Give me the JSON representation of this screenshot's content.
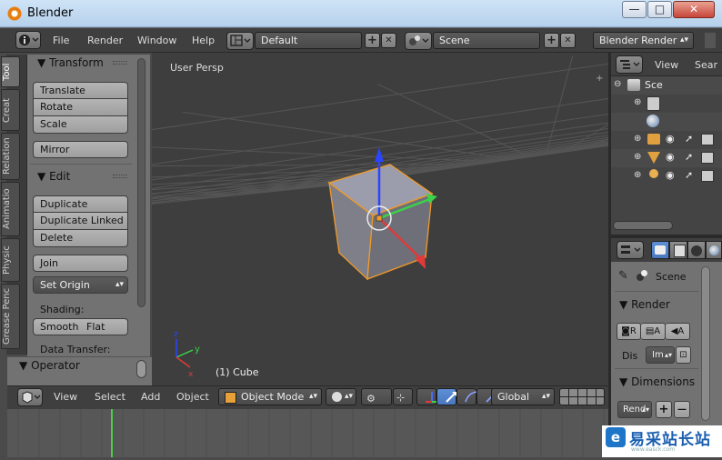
{
  "window": {
    "title": "Blender",
    "minimize_glyph": "—",
    "maximize_glyph": "□",
    "close_glyph": "✕"
  },
  "top_header": {
    "menus": [
      "File",
      "Render",
      "Window",
      "Help"
    ],
    "layout": "Default",
    "scene": "Scene",
    "engine": "Blender Render",
    "add_glyph": "+",
    "remove_glyph": "✕"
  },
  "tool_tabs": [
    "Tool",
    "Creat",
    "Relation",
    "Animatio",
    "Physic",
    "Grease Penc"
  ],
  "toolshelf": {
    "transform": {
      "title": "Transform",
      "buttons": [
        "Translate",
        "Rotate",
        "Scale"
      ],
      "mirror": "Mirror"
    },
    "edit": {
      "title": "Edit",
      "buttons": [
        "Duplicate",
        "Duplicate Linked",
        "Delete"
      ],
      "join": "Join",
      "set_origin": "Set Origin",
      "shading_label": "Shading:",
      "smooth": "Smooth",
      "flat": "Flat",
      "data_transfer": "Data Transfer:"
    },
    "operator": {
      "title": "Operator"
    }
  },
  "viewport": {
    "view_label": "User Persp",
    "object_label": "(1) Cube",
    "axis_x": "x",
    "axis_y": "y",
    "axis_z": "z",
    "colors": {
      "x_axis": "#e03a3a",
      "y_axis": "#3ad34a",
      "z_axis": "#2a45ff",
      "outline": "#f09a28"
    }
  },
  "viewport_header": {
    "menus": [
      "View",
      "Select",
      "Add",
      "Object"
    ],
    "mode": "Object Mode",
    "orientation": "Global"
  },
  "outliner": {
    "menu_view": "View",
    "menu_search": "Sear",
    "scene_label": "Sce"
  },
  "properties": {
    "scene_label": "Scene",
    "render_title": "Render",
    "render_btn": "R",
    "anim_btn": "A",
    "audio_btn": "A",
    "display_label": "Dis",
    "display_value": "Im",
    "dimensions_title": "Dimensions",
    "preset_value": "Rend",
    "add_glyph": "+",
    "remove_glyph": "—"
  },
  "watermark": {
    "logo": "e",
    "text": "易采站长站",
    "sub": "www.easck.com"
  }
}
